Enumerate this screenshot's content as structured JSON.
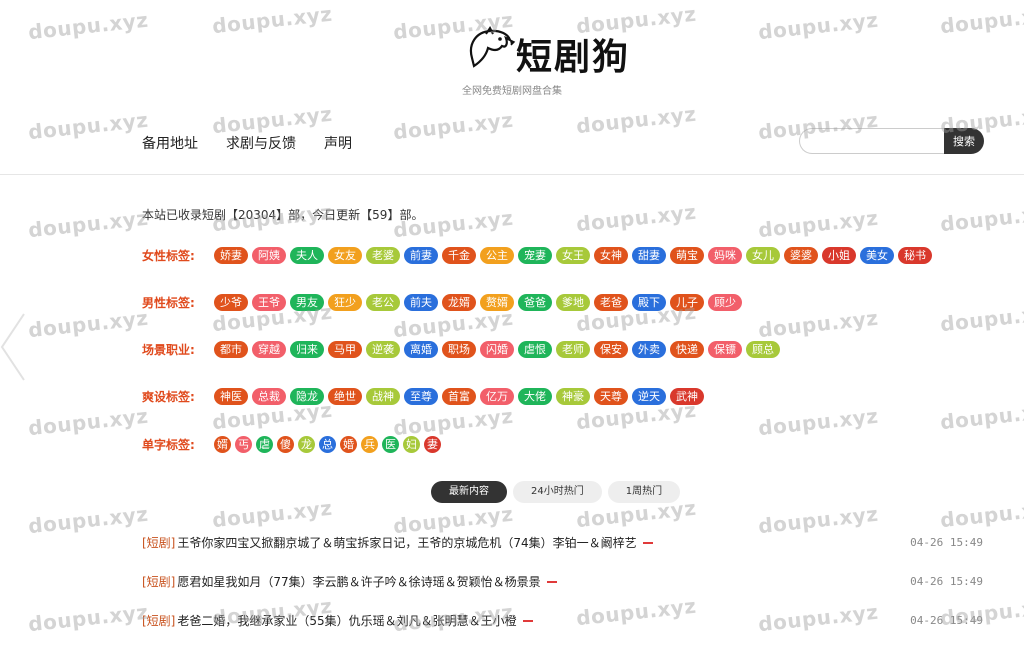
{
  "site": {
    "logo_text": "短剧狗",
    "tagline": "全网免费短剧网盘合集",
    "watermark": "doupu.xyz"
  },
  "nav": {
    "items": [
      {
        "label": "备用地址"
      },
      {
        "label": "求剧与反馈"
      },
      {
        "label": "声明"
      }
    ]
  },
  "search": {
    "placeholder": "",
    "button_label": "搜索"
  },
  "stats": {
    "text": "本站已收录短剧【20304】部，今日更新【59】部。"
  },
  "tag_groups": [
    {
      "label": "女性标签:",
      "tags": [
        {
          "text": "娇妻",
          "color": "#e0531c"
        },
        {
          "text": "阿姨",
          "color": "#f25f6a"
        },
        {
          "text": "夫人",
          "color": "#1fb55a"
        },
        {
          "text": "女友",
          "color": "#f2a01e"
        },
        {
          "text": "老婆",
          "color": "#a7c93a"
        },
        {
          "text": "前妻",
          "color": "#2a6fdc"
        },
        {
          "text": "千金",
          "color": "#e0531c"
        },
        {
          "text": "公主",
          "color": "#f2a01e"
        },
        {
          "text": "宠妻",
          "color": "#1fb55a"
        },
        {
          "text": "女王",
          "color": "#a7c93a"
        },
        {
          "text": "女神",
          "color": "#e0531c"
        },
        {
          "text": "甜妻",
          "color": "#2a6fdc"
        },
        {
          "text": "萌宝",
          "color": "#e0531c"
        },
        {
          "text": "妈咪",
          "color": "#f25f6a"
        },
        {
          "text": "女儿",
          "color": "#a7c93a"
        },
        {
          "text": "婆婆",
          "color": "#e0531c"
        },
        {
          "text": "小姐",
          "color": "#d9382c"
        },
        {
          "text": "美女",
          "color": "#2a6fdc"
        },
        {
          "text": "秘书",
          "color": "#d9382c"
        }
      ]
    },
    {
      "label": "男性标签:",
      "tags": [
        {
          "text": "少爷",
          "color": "#e0531c"
        },
        {
          "text": "王爷",
          "color": "#f25f6a"
        },
        {
          "text": "男友",
          "color": "#1fb55a"
        },
        {
          "text": "狂少",
          "color": "#f2a01e"
        },
        {
          "text": "老公",
          "color": "#a7c93a"
        },
        {
          "text": "前夫",
          "color": "#2a6fdc"
        },
        {
          "text": "龙婿",
          "color": "#e0531c"
        },
        {
          "text": "赘婿",
          "color": "#f2a01e"
        },
        {
          "text": "爸爸",
          "color": "#1fb55a"
        },
        {
          "text": "爹地",
          "color": "#a7c93a"
        },
        {
          "text": "老爸",
          "color": "#e0531c"
        },
        {
          "text": "殿下",
          "color": "#2a6fdc"
        },
        {
          "text": "儿子",
          "color": "#e0531c"
        },
        {
          "text": "顾少",
          "color": "#f25f6a"
        }
      ]
    },
    {
      "label": "场景职业:",
      "tags": [
        {
          "text": "都市",
          "color": "#e0531c"
        },
        {
          "text": "穿越",
          "color": "#f25f6a"
        },
        {
          "text": "归来",
          "color": "#1fb55a"
        },
        {
          "text": "马甲",
          "color": "#e0531c"
        },
        {
          "text": "逆袭",
          "color": "#a7c93a"
        },
        {
          "text": "离婚",
          "color": "#2a6fdc"
        },
        {
          "text": "职场",
          "color": "#e0531c"
        },
        {
          "text": "闪婚",
          "color": "#f25f6a"
        },
        {
          "text": "虐恨",
          "color": "#1fb55a"
        },
        {
          "text": "老师",
          "color": "#a7c93a"
        },
        {
          "text": "保安",
          "color": "#e0531c"
        },
        {
          "text": "外卖",
          "color": "#2a6fdc"
        },
        {
          "text": "快递",
          "color": "#e0531c"
        },
        {
          "text": "保镖",
          "color": "#f25f6a"
        },
        {
          "text": "顾总",
          "color": "#a7c93a"
        }
      ]
    },
    {
      "label": "爽设标签:",
      "tags": [
        {
          "text": "神医",
          "color": "#e0531c"
        },
        {
          "text": "总裁",
          "color": "#f25f6a"
        },
        {
          "text": "隐龙",
          "color": "#1fb55a"
        },
        {
          "text": "绝世",
          "color": "#e0531c"
        },
        {
          "text": "战神",
          "color": "#a7c93a"
        },
        {
          "text": "至尊",
          "color": "#2a6fdc"
        },
        {
          "text": "首富",
          "color": "#e0531c"
        },
        {
          "text": "亿万",
          "color": "#f25f6a"
        },
        {
          "text": "大佬",
          "color": "#1fb55a"
        },
        {
          "text": "神豪",
          "color": "#a7c93a"
        },
        {
          "text": "天尊",
          "color": "#e0531c"
        },
        {
          "text": "逆天",
          "color": "#2a6fdc"
        },
        {
          "text": "武神",
          "color": "#d9382c"
        }
      ]
    },
    {
      "label": "单字标签:",
      "single": true,
      "tags": [
        {
          "text": "婿",
          "color": "#e0531c"
        },
        {
          "text": "丐",
          "color": "#f25f6a"
        },
        {
          "text": "虐",
          "color": "#1fb55a"
        },
        {
          "text": "傻",
          "color": "#e0531c"
        },
        {
          "text": "龙",
          "color": "#a7c93a"
        },
        {
          "text": "总",
          "color": "#2a6fdc"
        },
        {
          "text": "婚",
          "color": "#e0531c"
        },
        {
          "text": "兵",
          "color": "#f2a01e"
        },
        {
          "text": "医",
          "color": "#1fb55a"
        },
        {
          "text": "妇",
          "color": "#a7c93a"
        },
        {
          "text": "妻",
          "color": "#d9382c"
        }
      ]
    }
  ],
  "tabs": [
    {
      "label": "最新内容",
      "active": true
    },
    {
      "label": "24小时热门",
      "active": false
    },
    {
      "label": "1周热门",
      "active": false
    }
  ],
  "list": {
    "items": [
      {
        "category": "[短剧]",
        "title": "王爷你家四宝又掀翻京城了＆萌宝拆家日记，王爷的京城危机（74集）李铂一＆阚梓艺",
        "time": "04-26 15:49"
      },
      {
        "category": "[短剧]",
        "title": "愿君如星我如月（77集）李云鹏＆许子吟＆徐诗瑶＆贺颖怡＆杨景景",
        "time": "04-26 15:49"
      },
      {
        "category": "[短剧]",
        "title": "老爸二婚，我继承家业（55集）仇乐瑶＆刘凡＆张明慧＆王小橙",
        "time": "04-26 15:49"
      }
    ]
  }
}
